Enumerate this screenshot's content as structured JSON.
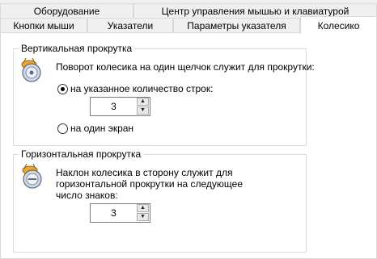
{
  "tabs_row1": [
    {
      "label": "Оборудование"
    },
    {
      "label": "Центр управления мышью и клавиатурой"
    }
  ],
  "tabs_row2": [
    {
      "label": "Кнопки мыши"
    },
    {
      "label": "Указатели"
    },
    {
      "label": "Параметры указателя"
    },
    {
      "label": "Колесико",
      "active": true
    }
  ],
  "vertical": {
    "title": "Вертикальная прокрутка",
    "description": "Поворот колесика на один щелчок служит для прокрутки:",
    "option_lines": "на указанное количество строк:",
    "option_lines_selected": true,
    "lines_value": "3",
    "option_screen": "на один экран",
    "icon": "mouse-wheel-vertical-icon"
  },
  "horizontal": {
    "title": "Горизонтальная прокрутка",
    "description_line1": "Наклон колесика в сторону служит для",
    "description_line2": "горизонтальной прокрутки на следующее",
    "description_line3": "число знаков:",
    "chars_value": "3",
    "icon": "mouse-wheel-horizontal-icon"
  }
}
